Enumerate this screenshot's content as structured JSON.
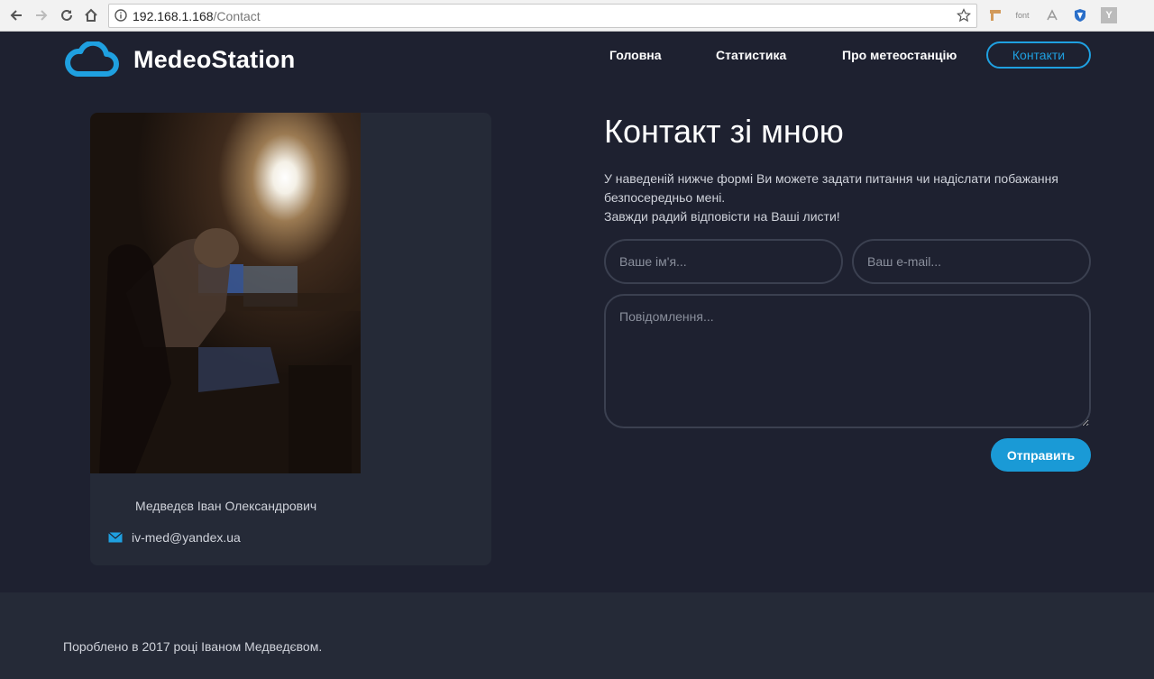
{
  "browser": {
    "url_host": "192.168.1.168",
    "url_path": "/Contact",
    "ext_font_label": "font",
    "ext_y_label": "Y"
  },
  "site": {
    "logo_text": "MedeoStation",
    "nav": {
      "home": "Головна",
      "stats": "Статистика",
      "about": "Про метеостанцію",
      "contacts": "Контакти"
    }
  },
  "profile": {
    "name": "Медведєв Іван Олександрович",
    "email": "iv-med@yandex.ua"
  },
  "contact_form": {
    "title": "Контакт зі мною",
    "desc_line1": "У наведеній нижче формі Ви можете задати питання чи надіслати побажання безпосередньо мені.",
    "desc_line2": "Завжди радий відповісти на Ваші листи!",
    "name_placeholder": "Ваше ім'я...",
    "email_placeholder": "Ваш e-mail...",
    "message_placeholder": "Повідомлення...",
    "send_label": "Отправить"
  },
  "footer": {
    "text": "Пороблено в 2017 році Іваном Медведєвом."
  },
  "colors": {
    "background": "#1e2130",
    "card": "#252a37",
    "accent": "#1a9ad6"
  }
}
